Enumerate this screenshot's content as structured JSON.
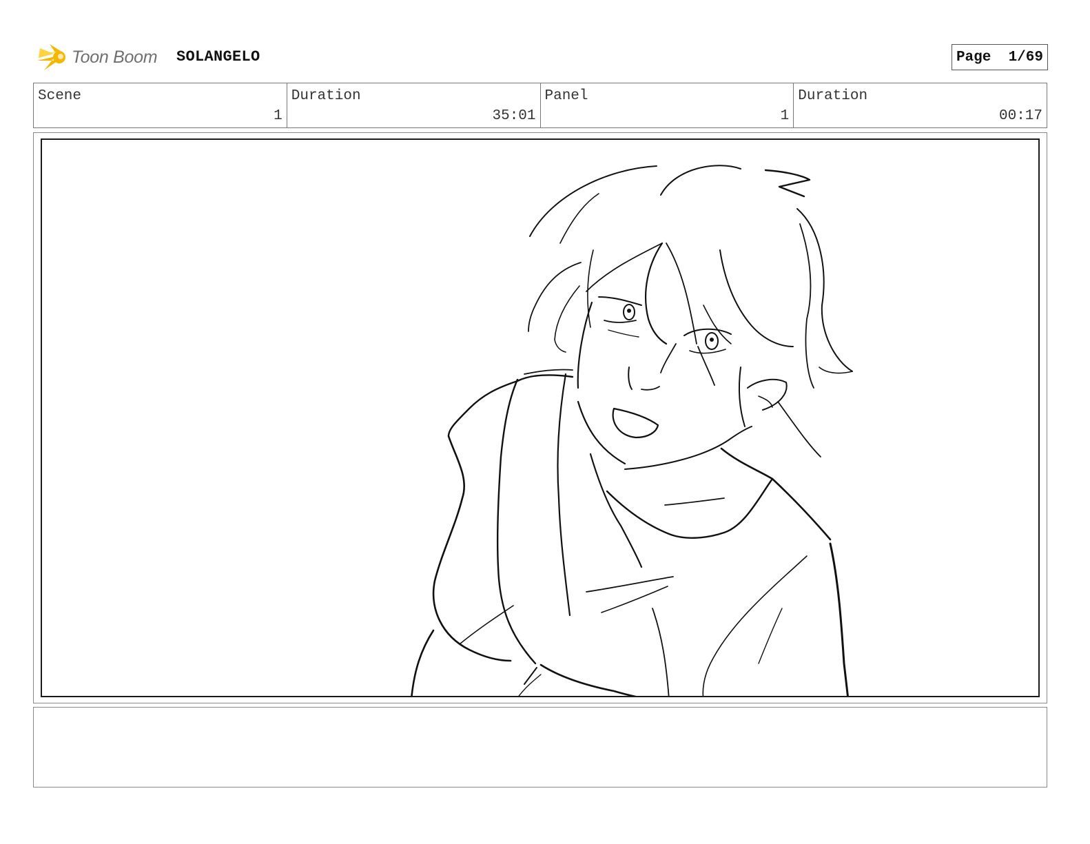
{
  "header": {
    "logo_text": "Toon Boom",
    "project_title": "SOLANGELO",
    "page_label": "Page",
    "page_number": "1/69"
  },
  "info": {
    "scene_label": "Scene",
    "scene_value": "1",
    "scene_duration_label": "Duration",
    "scene_duration_value": "35:01",
    "panel_label": "Panel",
    "panel_value": "1",
    "panel_duration_label": "Duration",
    "panel_duration_value": "00:17"
  },
  "notes": {
    "text": ""
  },
  "colors": {
    "logo_spark": "#f5b800",
    "logo_text": "#6f6f6f",
    "sketch_line": "#111111"
  },
  "icons": {
    "logo": "toon-boom-spark-icon"
  }
}
